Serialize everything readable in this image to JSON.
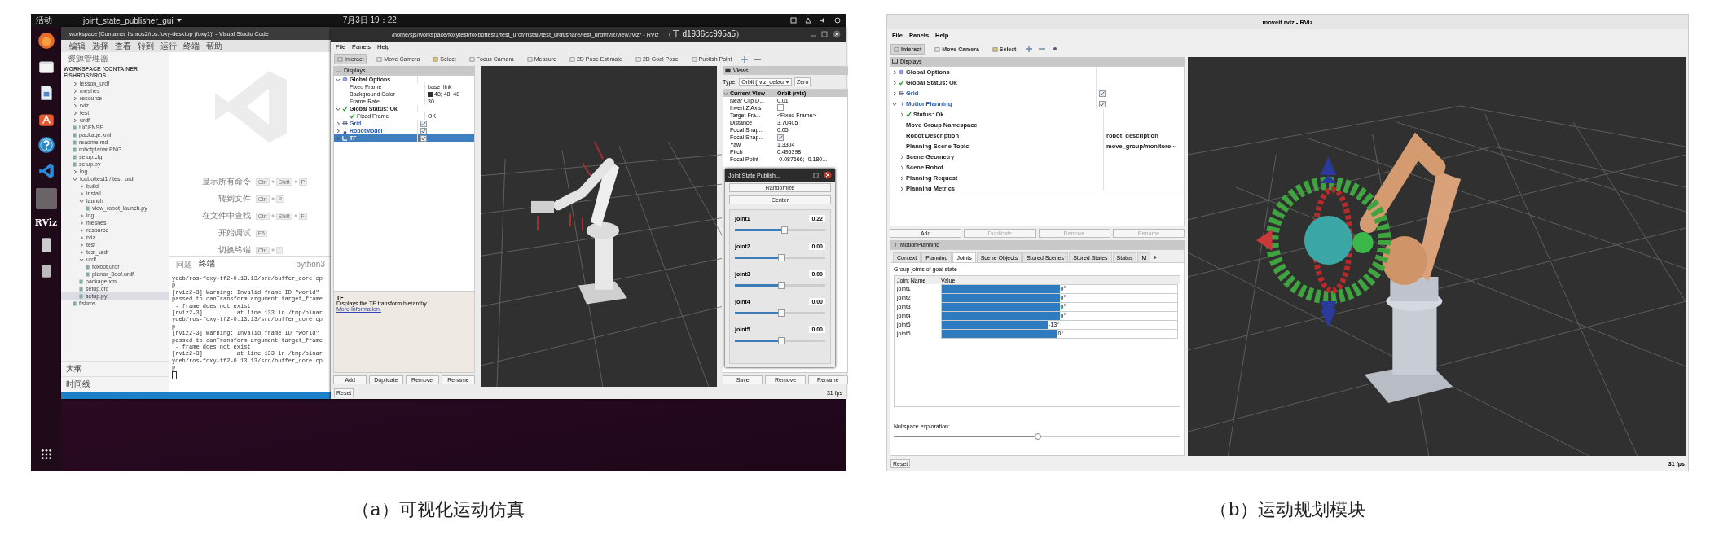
{
  "figure_a": {
    "top_bar": {
      "activities": "活动",
      "app_menu": "joint_state_publisher_gui",
      "clock": "7月3日 19：22"
    },
    "dock": {
      "rviz_label": "RViz"
    },
    "vscode": {
      "title": "workspace [Container fishros2/ros:foxy-desktop (foxy1)] - Visual Studio Code",
      "menu": [
        "编辑",
        "选择",
        "查看",
        "转到",
        "运行",
        "终端",
        "帮助"
      ],
      "explorer_title": "资源管理器",
      "workspace_header": "WORKSPACE [CONTAINER FISHROS2/ROS...",
      "tree": [
        {
          "label": "lesson_urdf",
          "kind": "folder",
          "expanded": false,
          "selected": false
        },
        {
          "label": "meshes",
          "kind": "folder",
          "expanded": false,
          "selected": false
        },
        {
          "label": "resource",
          "kind": "folder",
          "expanded": false,
          "selected": false
        },
        {
          "label": "rviz",
          "kind": "folder",
          "expanded": false,
          "selected": false
        },
        {
          "label": "test",
          "kind": "folder",
          "expanded": false,
          "selected": false
        },
        {
          "label": "urdf",
          "kind": "folder",
          "expanded": false,
          "selected": false
        },
        {
          "label": "LICENSE",
          "kind": "file",
          "selected": false
        },
        {
          "label": "package.xml",
          "kind": "file",
          "selected": false
        },
        {
          "label": "readme.md",
          "kind": "file",
          "selected": false
        },
        {
          "label": "robotplanar.PNG",
          "kind": "file",
          "selected": false
        },
        {
          "label": "setup.cfg",
          "kind": "file",
          "selected": false
        },
        {
          "label": "setup.py",
          "kind": "file",
          "selected": false
        },
        {
          "label": "log",
          "kind": "folder",
          "expanded": false,
          "selected": false
        },
        {
          "label": "foxbottest1 / test_urdf",
          "kind": "folder",
          "expanded": true,
          "selected": false,
          "children": [
            {
              "label": "build",
              "kind": "folder",
              "expanded": false,
              "selected": false
            },
            {
              "label": "install",
              "kind": "folder",
              "expanded": false,
              "selected": false
            },
            {
              "label": "launch",
              "kind": "folder",
              "expanded": true,
              "selected": false,
              "children": [
                {
                  "label": "view_robot_launch.py",
                  "kind": "file",
                  "selected": false
                }
              ]
            },
            {
              "label": "log",
              "kind": "folder",
              "expanded": false,
              "selected": false
            },
            {
              "label": "meshes",
              "kind": "folder",
              "expanded": false,
              "selected": false
            },
            {
              "label": "resource",
              "kind": "folder",
              "expanded": false,
              "selected": false
            },
            {
              "label": "rviz",
              "kind": "folder",
              "expanded": false,
              "selected": false
            },
            {
              "label": "test",
              "kind": "folder",
              "expanded": false,
              "selected": false
            },
            {
              "label": "test_urdf",
              "kind": "folder",
              "expanded": false,
              "selected": false
            },
            {
              "label": "urdf",
              "kind": "folder",
              "expanded": true,
              "selected": false,
              "children": [
                {
                  "label": "foxbot.urdf",
                  "kind": "file",
                  "selected": false
                },
                {
                  "label": "planar_3dof.urdf",
                  "kind": "file",
                  "selected": false
                }
              ]
            },
            {
              "label": "package.xml",
              "kind": "file",
              "selected": false
            },
            {
              "label": "setup.cfg",
              "kind": "file",
              "selected": false
            },
            {
              "label": "setup.py",
              "kind": "file",
              "selected": true
            }
          ]
        },
        {
          "label": "fishros",
          "kind": "file",
          "selected": false
        }
      ],
      "outline": "大纲",
      "timeline": "时间线",
      "shortcuts": [
        {
          "label": "显示所有命令",
          "keys": [
            "Ctrl",
            "Shift",
            "P"
          ]
        },
        {
          "label": "转到文件",
          "keys": [
            "Ctrl",
            "P"
          ]
        },
        {
          "label": "在文件中查找",
          "keys": [
            "Ctrl",
            "Shift",
            "F"
          ]
        },
        {
          "label": "开始调试",
          "keys": [
            "F5"
          ]
        },
        {
          "label": "切换终端",
          "keys": [
            "Ctrl",
            "`"
          ]
        }
      ],
      "terminal_tabs": [
        {
          "label": "问题",
          "selected": false
        },
        {
          "label": "终端",
          "selected": true
        }
      ],
      "terminal_shell": "python3",
      "terminal_lines": [
        "ydeb/ros-foxy-tf2-0.13.13/src/buffer_core.cp",
        "p",
        "[rviz2-3] Warning: Invalid frame ID \"world\"",
        "passed to canTransform argument target_frame",
        " - frame does not exist",
        "[rviz2-3]          at line 133 in /tmp/binar",
        "ydeb/ros-foxy-tf2-0.13.13/src/buffer_core.cp",
        "p",
        "[rviz2-3] Warning: Invalid frame ID \"world\"",
        "passed to canTransform argument target_frame",
        " - frame does not exist",
        "[rviz2-3]          at line 133 in /tmp/binar",
        "ydeb/ros-foxy-tf2-0.13.13/src/buffer_core.cp",
        "p"
      ]
    },
    "rviz": {
      "title": "/home/sjs/workspace/foxytest/foxbottest1/test_urdf/install/test_urdf/share/test_urdf/rviz/view.rviz* - RViz",
      "title_host": "（于 d1936cc995a5）",
      "menu": [
        "File",
        "Panels",
        "Help"
      ],
      "tools": [
        {
          "label": "Interact",
          "selected": true
        },
        {
          "label": "Move Camera",
          "selected": false
        },
        {
          "label": "Select",
          "selected": false
        },
        {
          "label": "Focus Camera",
          "selected": false
        },
        {
          "label": "Measure",
          "selected": false
        },
        {
          "label": "2D Pose Estimate",
          "selected": false
        },
        {
          "label": "2D Goal Pose",
          "selected": false
        },
        {
          "label": "Publish Point",
          "selected": false
        }
      ],
      "displays": {
        "title": "Displays",
        "tree": [
          {
            "label": "Global Options",
            "kind": "options",
            "expanded": true,
            "selected": false,
            "children": [
              {
                "label": "Fixed Frame",
                "kind": "property",
                "value": "base_link",
                "selected": false
              },
              {
                "label": "Background Color",
                "kind": "property",
                "value": "48; 48; 48",
                "color": "#303030",
                "selected": false
              },
              {
                "label": "Frame Rate",
                "kind": "property",
                "value": "30",
                "selected": false
              }
            ]
          },
          {
            "label": "Global Status: Ok",
            "kind": "status",
            "expanded": true,
            "selected": false,
            "children": [
              {
                "label": "Fixed Frame",
                "kind": "status",
                "value": "OK",
                "selected": false
              }
            ]
          },
          {
            "label": "Grid",
            "kind": "grid",
            "expanded": false,
            "checked": true,
            "selected": false
          },
          {
            "label": "RobotModel",
            "kind": "robot",
            "expanded": false,
            "checked": true,
            "selected": false
          },
          {
            "label": "TF",
            "kind": "tf",
            "expanded": false,
            "checked": true,
            "selected": true
          }
        ]
      },
      "description": {
        "title": "TF",
        "text": "Displays the TF transform hierarchy.",
        "link": "More Information."
      },
      "buttons": [
        "Add",
        "Duplicate",
        "Remove",
        "Rename"
      ],
      "reset": "Reset",
      "views": {
        "title": "Views",
        "type_label": "Type:",
        "type_value": "Orbit (rviz_defau",
        "zero": "Zero",
        "current": {
          "label": "Current View",
          "value": "Orbit (rviz)"
        },
        "props": [
          {
            "label": "Near Clip D...",
            "kind": "text",
            "value": "0.01"
          },
          {
            "label": "Invert Z Axis",
            "kind": "checkbox",
            "checked": false
          },
          {
            "label": "Target Fra...",
            "kind": "text",
            "value": "<Fixed Frame>"
          },
          {
            "label": "Distance",
            "kind": "text",
            "value": "3.70405"
          },
          {
            "label": "Focal Shap...",
            "kind": "text",
            "value": "0.05"
          },
          {
            "label": "Focal Shap...",
            "kind": "checkbox",
            "checked": true
          },
          {
            "label": "Yaw",
            "kind": "text",
            "value": "1.3304"
          },
          {
            "label": "Pitch",
            "kind": "text",
            "value": "0.495398"
          },
          {
            "label": "Focal Point",
            "kind": "text",
            "value": "-0.087666; -0.180..."
          }
        ],
        "buttons": [
          "Save",
          "Remove",
          "Rename"
        ]
      },
      "fps": "31 fps"
    },
    "joint_publisher": {
      "title": "Joint State Publish...",
      "buttons": [
        "Randomize",
        "Center"
      ],
      "joints": [
        {
          "name": "joint1",
          "reading": "0.22",
          "level": 0.54
        },
        {
          "name": "joint2",
          "reading": "0.00",
          "level": 0.5
        },
        {
          "name": "joint3",
          "reading": "0.00",
          "level": 0.5
        },
        {
          "name": "joint4",
          "reading": "0.00",
          "level": 0.5
        },
        {
          "name": "joint5",
          "reading": "0.00",
          "level": 0.5
        }
      ]
    },
    "caption": "（a）可视化运动仿真"
  },
  "figure_b": {
    "title": "moveit.rviz - RViz",
    "menu": [
      "File",
      "Panels",
      "Help"
    ],
    "tools": [
      {
        "label": "Interact",
        "selected": true
      },
      {
        "label": "Move Camera",
        "selected": false
      },
      {
        "label": "Select",
        "selected": false
      }
    ],
    "displays": {
      "title": "Displays",
      "tree": [
        {
          "label": "Global Options",
          "kind": "options",
          "expanded": false,
          "selected": false
        },
        {
          "label": "Global Status: Ok",
          "kind": "status",
          "expanded": false,
          "selected": false
        },
        {
          "label": "Grid",
          "kind": "grid",
          "expanded": false,
          "checked": true,
          "selected": false
        },
        {
          "label": "MotionPlanning",
          "kind": "motion",
          "expanded": true,
          "checked": true,
          "selected": false,
          "children": [
            {
              "label": "Status: Ok",
              "kind": "status",
              "expanded": false,
              "selected": false
            },
            {
              "label": "Move Group Namespace",
              "kind": "property",
              "selected": false
            },
            {
              "label": "Robot Description",
              "kind": "property",
              "value": "robot_description",
              "selected": false
            },
            {
              "label": "Planning Scene Topic",
              "kind": "property",
              "value": "move_group/monitore···",
              "selected": false
            },
            {
              "label": "Scene Geometry",
              "kind": "property",
              "expanded": false,
              "selected": false
            },
            {
              "label": "Scene Robot",
              "kind": "property",
              "expanded": false,
              "selected": false
            },
            {
              "label": "Planning Request",
              "kind": "property",
              "expanded": false,
              "selected": false
            },
            {
              "label": "Planning Metrics",
              "kind": "property",
              "expanded": false,
              "selected": false
            }
          ]
        }
      ]
    },
    "buttons": [
      {
        "label": "Add",
        "disabled": false
      },
      {
        "label": "Duplicate",
        "disabled": true
      },
      {
        "label": "Remove",
        "disabled": true
      },
      {
        "label": "Rename",
        "disabled": true
      }
    ],
    "motion_planning": {
      "title": "MotionPlanning",
      "tabs": [
        {
          "label": "Context",
          "selected": false
        },
        {
          "label": "Planning",
          "selected": false
        },
        {
          "label": "Joints",
          "selected": true
        },
        {
          "label": "Scene Objects",
          "selected": false
        },
        {
          "label": "Stored Scenes",
          "selected": false
        },
        {
          "label": "Stored States",
          "selected": false
        },
        {
          "label": "Status",
          "selected": false
        },
        {
          "label": "M",
          "selected": false
        }
      ],
      "heading": "Group joints of goal state",
      "columns": [
        "Joint Name",
        "Value"
      ],
      "joints": [
        {
          "name": "joint1",
          "reading": "0°",
          "level": 0.5
        },
        {
          "name": "joint2",
          "reading": "0°",
          "level": 0.5
        },
        {
          "name": "joint3",
          "reading": "0°",
          "level": 0.5
        },
        {
          "name": "joint4",
          "reading": "0°",
          "level": 0.5
        },
        {
          "name": "joint5",
          "reading": "-13°",
          "level": 0.45
        },
        {
          "name": "joint6",
          "reading": "0°",
          "level": 0.49
        }
      ],
      "nullspace_label": "Nullspace exploration:",
      "nullspace": {
        "level": 0.5
      }
    },
    "reset": "Reset",
    "fps": "31 fps",
    "caption": "（b）运动规划模块"
  }
}
